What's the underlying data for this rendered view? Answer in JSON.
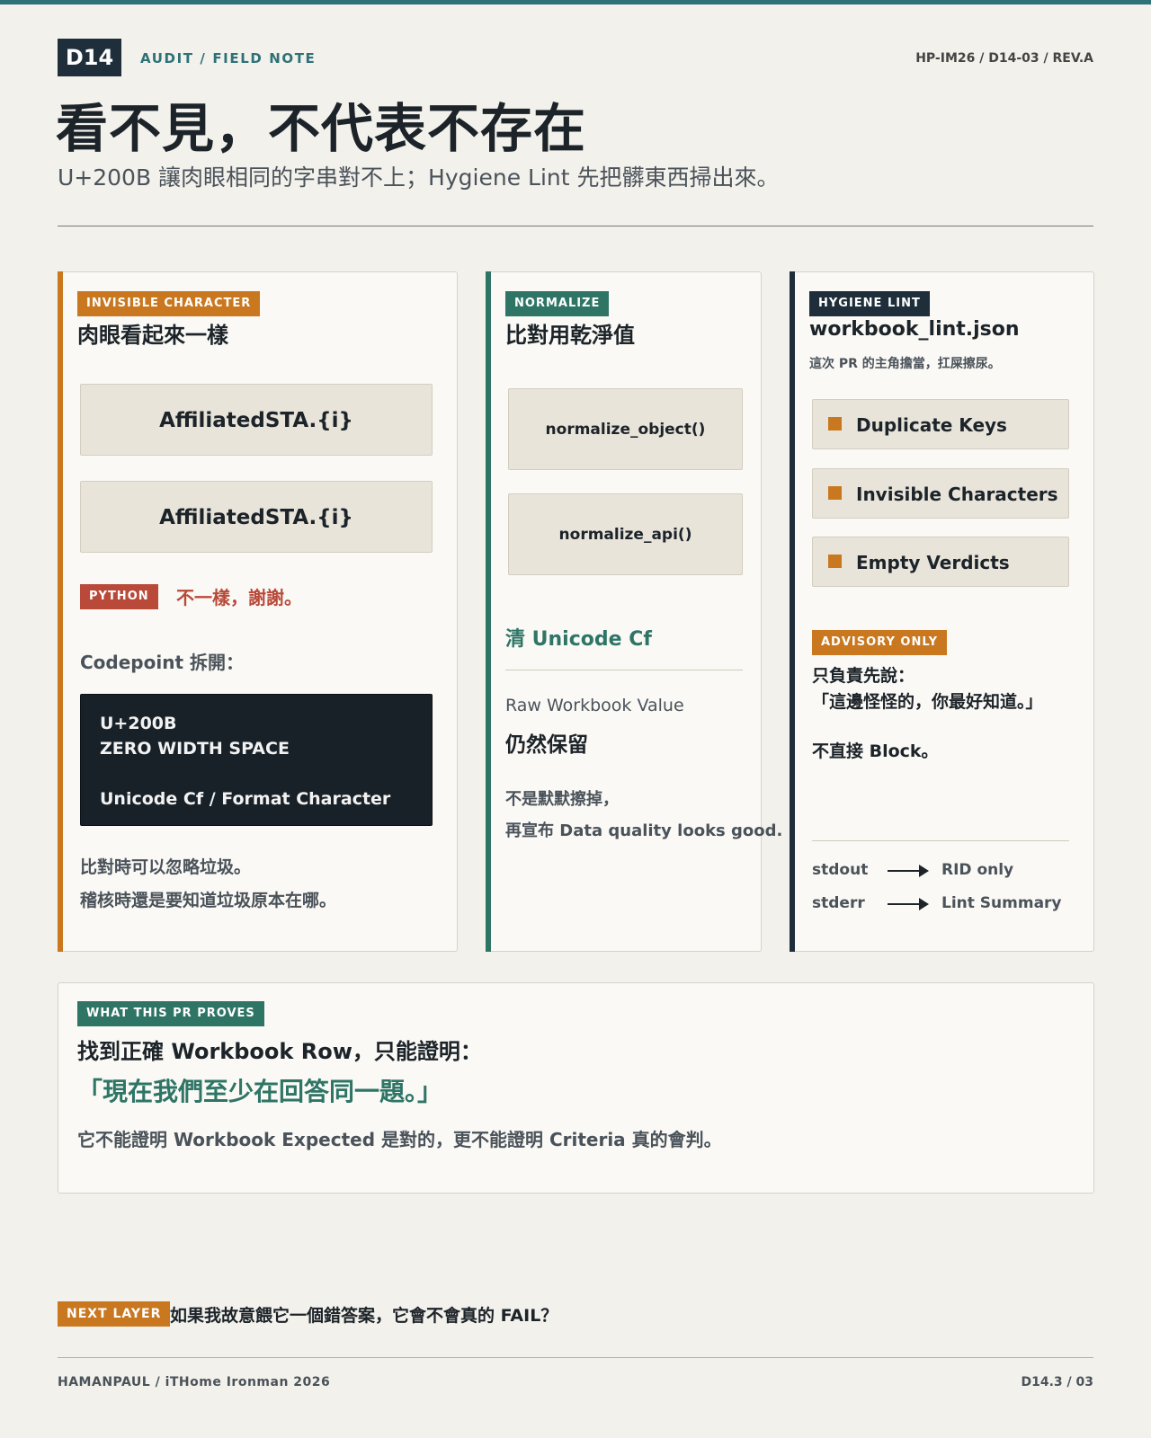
{
  "header": {
    "badge": "D14",
    "kicker": "AUDIT / FIELD NOTE",
    "ref": "HP-IM26 / D14-03 / REV.A",
    "title": "看不見，不代表不存在",
    "subtitle": "U+200B 讓肉眼相同的字串對不上；Hygiene Lint 先把髒東西掃出來。"
  },
  "card1": {
    "tag": "INVISIBLE CHARACTER",
    "heading": "肉眼看起來一樣",
    "string_a": "AffiliatedSTA.{i}",
    "string_b": "AffiliatedSTA.{i}",
    "python_tag": "PYTHON",
    "python_verdict": "不一樣，謝謝。",
    "codepoint_label": "Codepoint 拆開：",
    "codepoint": {
      "line1": "U+200B",
      "line2": "ZERO WIDTH SPACE",
      "line3": "Unicode Cf / Format Character"
    },
    "note1": "比對時可以忽略垃圾。",
    "note2": "稽核時還是要知道垃圾原本在哪。"
  },
  "card2": {
    "tag": "NORMALIZE",
    "heading": "比對用乾淨值",
    "fn1": "normalize_object()",
    "fn2": "normalize_api()",
    "clean": "清 Unicode Cf",
    "raw_label": "Raw Workbook Value",
    "raw_value": "仍然保留",
    "note1": "不是默默擦掉，",
    "note2": "再宣布 Data quality looks good."
  },
  "card3": {
    "tag": "HYGIENE LINT",
    "heading": "workbook_lint.json",
    "caption": "這次 PR 的主角擔當，扛屎擦尿。",
    "items": [
      {
        "label": "Duplicate Keys"
      },
      {
        "label": "Invisible Characters"
      },
      {
        "label": "Empty Verdicts"
      }
    ],
    "advisory_tag": "ADVISORY ONLY",
    "advisory1": "只負責先說：",
    "advisory2": "「這邊怪怪的，你最好知道。」",
    "no_block": "不直接 Block。",
    "streams": [
      {
        "name": "stdout",
        "target": "RID only"
      },
      {
        "name": "stderr",
        "target": "Lint Summary"
      }
    ]
  },
  "card4": {
    "tag": "WHAT THIS PR PROVES",
    "line1": "找到正確 Workbook Row，只能證明：",
    "quote": "「現在我們至少在回答同一題。」",
    "line2": "它不能證明 Workbook Expected 是對的，更不能證明 Criteria 真的會判。"
  },
  "footer": {
    "next_tag": "NEXT LAYER",
    "next_question": "如果我故意餵它一個錯答案，它會不會真的 FAIL？",
    "left": "HAMANPAUL / iTHome Ironman 2026",
    "right": "D14.3 / 03"
  },
  "colors": {
    "accent_teal": "#2e7177",
    "orange": "#c97820",
    "green": "#2f7566",
    "navy": "#1e2e3b",
    "red": "#b94a3a",
    "background": "#f3f1eb"
  }
}
